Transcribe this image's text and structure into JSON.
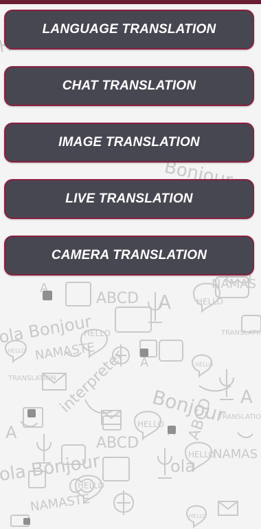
{
  "menu": {
    "buttons": [
      {
        "label": "LANGUAGE TRANSLATION"
      },
      {
        "label": "CHAT TRANSLATION"
      },
      {
        "label": "IMAGE TRANSLATION"
      },
      {
        "label": "LIVE TRANSLATION"
      },
      {
        "label": "CAMERA TRANSLATION"
      }
    ]
  },
  "background": {
    "words": [
      "Bonjour",
      "HELLO",
      "ABCD",
      "NAMASTE",
      "Hola",
      "Interpreter",
      "TRANSLATION",
      "A"
    ]
  },
  "colors": {
    "button_fill": "#474751",
    "button_border": "#8b1e3f",
    "top_strip": "#6a1d33",
    "page_background": "#f4f4f4"
  }
}
